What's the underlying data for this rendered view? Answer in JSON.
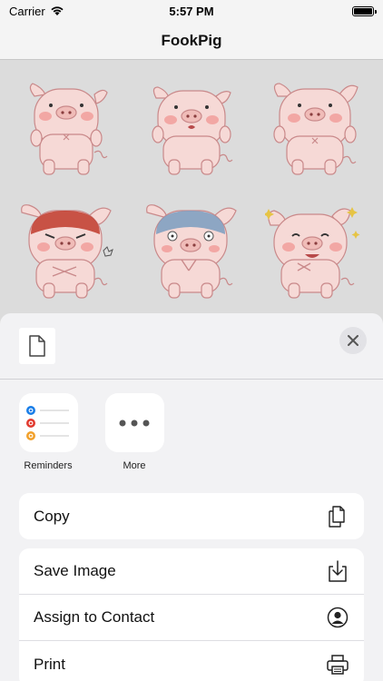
{
  "status_bar": {
    "carrier": "Carrier",
    "time": "5:57 PM",
    "signal_icon": "wifi-icon",
    "battery_icon": "battery-icon"
  },
  "nav": {
    "title": "FookPig"
  },
  "stickers": [
    {
      "name": "pig-sticker-standing"
    },
    {
      "name": "pig-sticker-surprised"
    },
    {
      "name": "pig-sticker-waving"
    },
    {
      "name": "pig-sticker-angry"
    },
    {
      "name": "pig-sticker-shocked"
    },
    {
      "name": "pig-sticker-happy"
    }
  ],
  "share_sheet": {
    "file_icon": "document-icon",
    "close_icon": "close-icon",
    "apps": [
      {
        "label": "Reminders",
        "icon": "reminders-icon"
      },
      {
        "label": "More",
        "icon": "more-icon"
      }
    ],
    "actions_group1": [
      {
        "label": "Copy",
        "icon": "copy-icon"
      }
    ],
    "actions_group2": [
      {
        "label": "Save Image",
        "icon": "save-image-icon"
      },
      {
        "label": "Assign to Contact",
        "icon": "contact-icon"
      },
      {
        "label": "Print",
        "icon": "print-icon"
      }
    ]
  },
  "colors": {
    "pig_body": "#f6d9d6",
    "pig_outline": "#c9898a",
    "blush": "#f2a7a4",
    "angry": "#c0392b",
    "shocked": "#7a9cc0"
  }
}
